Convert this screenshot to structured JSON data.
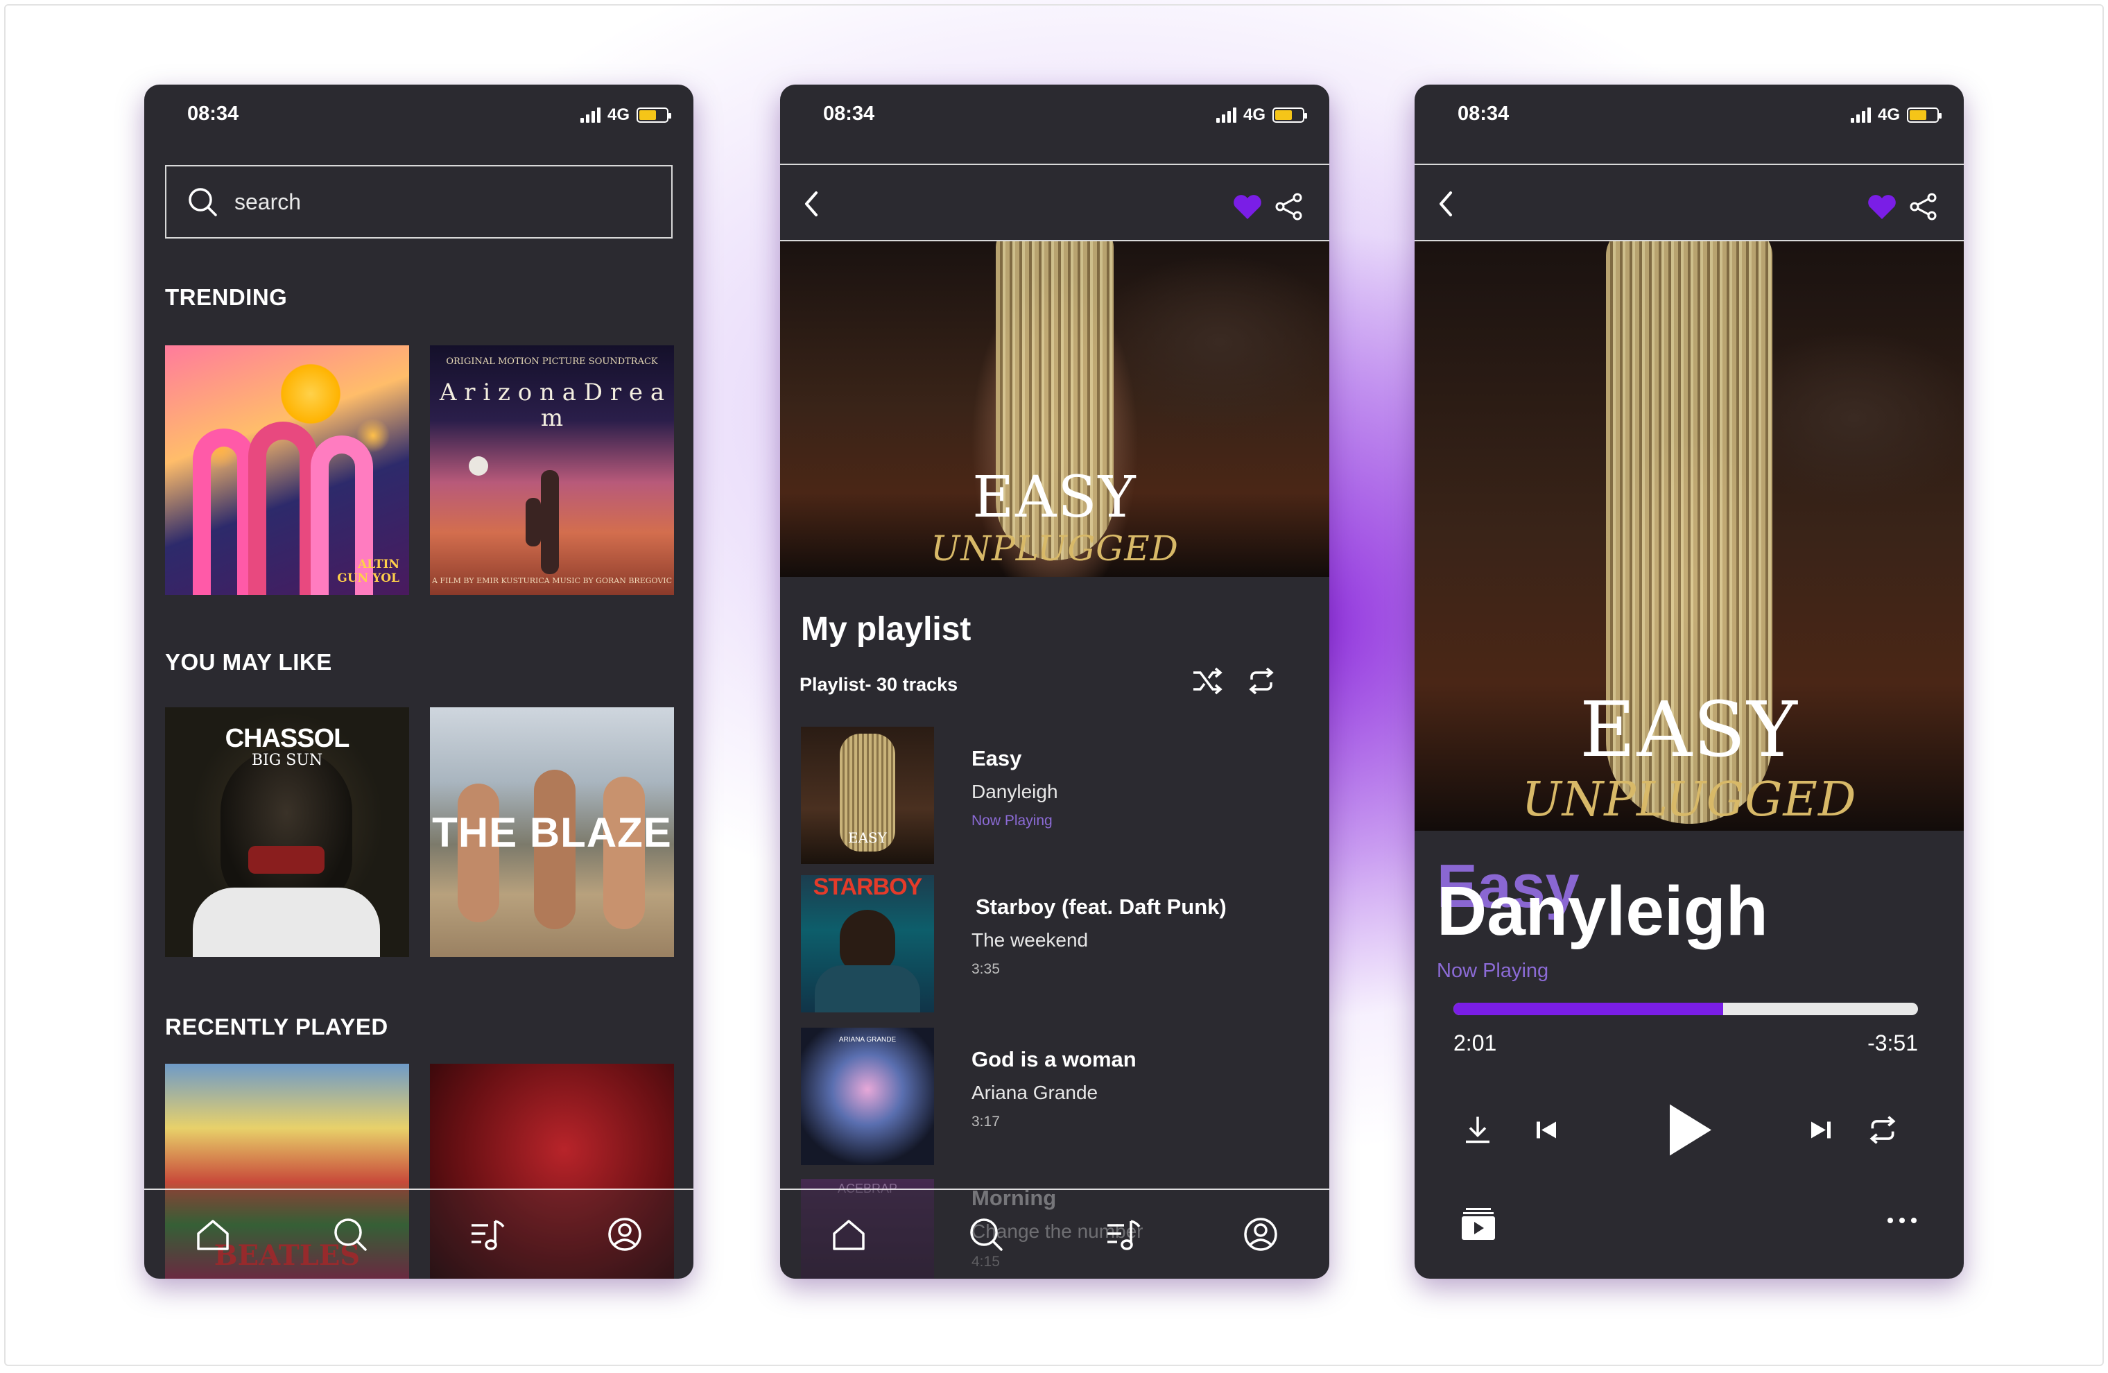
{
  "status": {
    "time": "08:34",
    "network": "4G"
  },
  "home": {
    "search_placeholder": "search",
    "sections": {
      "trending": "TRENDING",
      "you_may_like": "YOU MAY LIKE",
      "recently_played": "RECENTLY PLAYED"
    },
    "covers": {
      "altin_text": "ALTIN GUN YOL",
      "arizona_top": "ORIGINAL MOTION PICTURE SOUNDTRACK",
      "arizona_title": "A r i z o n a  D r e a m",
      "arizona_bottom": "A FILM BY EMIR KUSTURICA   MUSIC BY GORAN BREGOVIC",
      "chassol_title": "CHASSOL",
      "chassol_sub": "BIG SUN",
      "blaze": "THE BLAZE",
      "beatles": "BEATLES"
    }
  },
  "playlist": {
    "hero_title": "EASY",
    "hero_sub": "UNPLUGGED",
    "title": "My playlist",
    "subtitle": "Playlist- 30 tracks",
    "tracks": [
      {
        "name": "Easy",
        "artist": "Danyleigh",
        "meta": "Now Playing",
        "art": "EASY"
      },
      {
        "name": "Starboy (feat. Daft Punk)",
        "artist": "The weekend",
        "meta": "3:35",
        "art": "STARBOY"
      },
      {
        "name": "God is a woman",
        "artist": "Ariana Grande",
        "meta": "3:17",
        "art": "ARIANA GRANDE"
      },
      {
        "name": "Morning",
        "artist": "Change the number",
        "meta": "4:15",
        "art": "ACEBRAP"
      }
    ]
  },
  "player": {
    "hero_title": "EASY",
    "hero_sub": "UNPLUGGED",
    "song": "Easy",
    "artist": "Danyleigh",
    "status": "Now Playing",
    "elapsed": "2:01",
    "remaining": "-3:51",
    "progress_fraction": 0.58
  },
  "colors": {
    "accent": "#7a1ee6",
    "bg": "#2b2a30",
    "heart": "#7a1ee6"
  }
}
